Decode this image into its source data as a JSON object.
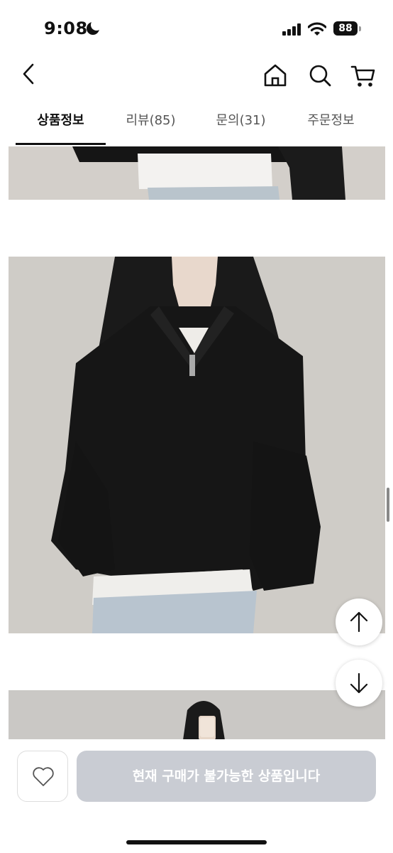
{
  "status_bar": {
    "time": "9:08",
    "battery": "88",
    "icons": [
      "moon-icon",
      "signal-icon",
      "wifi-icon",
      "battery-icon"
    ]
  },
  "nav": {
    "icons": [
      "back-chevron-icon",
      "home-icon",
      "search-icon",
      "cart-icon"
    ]
  },
  "tabs": [
    {
      "label": "상품정보",
      "active": true
    },
    {
      "label": "리뷰(85)",
      "active": false
    },
    {
      "label": "문의(31)",
      "active": false
    },
    {
      "label": "주문정보",
      "active": false
    }
  ],
  "floating_buttons": [
    "arrow-up-icon",
    "arrow-down-icon"
  ],
  "bottom_bar": {
    "wish_icon": "heart-icon",
    "buy_label": "현재 구매가 불가능한 상품입니다"
  },
  "colors": {
    "accent": "#111111",
    "disabled_button": "#c9ccd3",
    "sweater": "#161616"
  }
}
